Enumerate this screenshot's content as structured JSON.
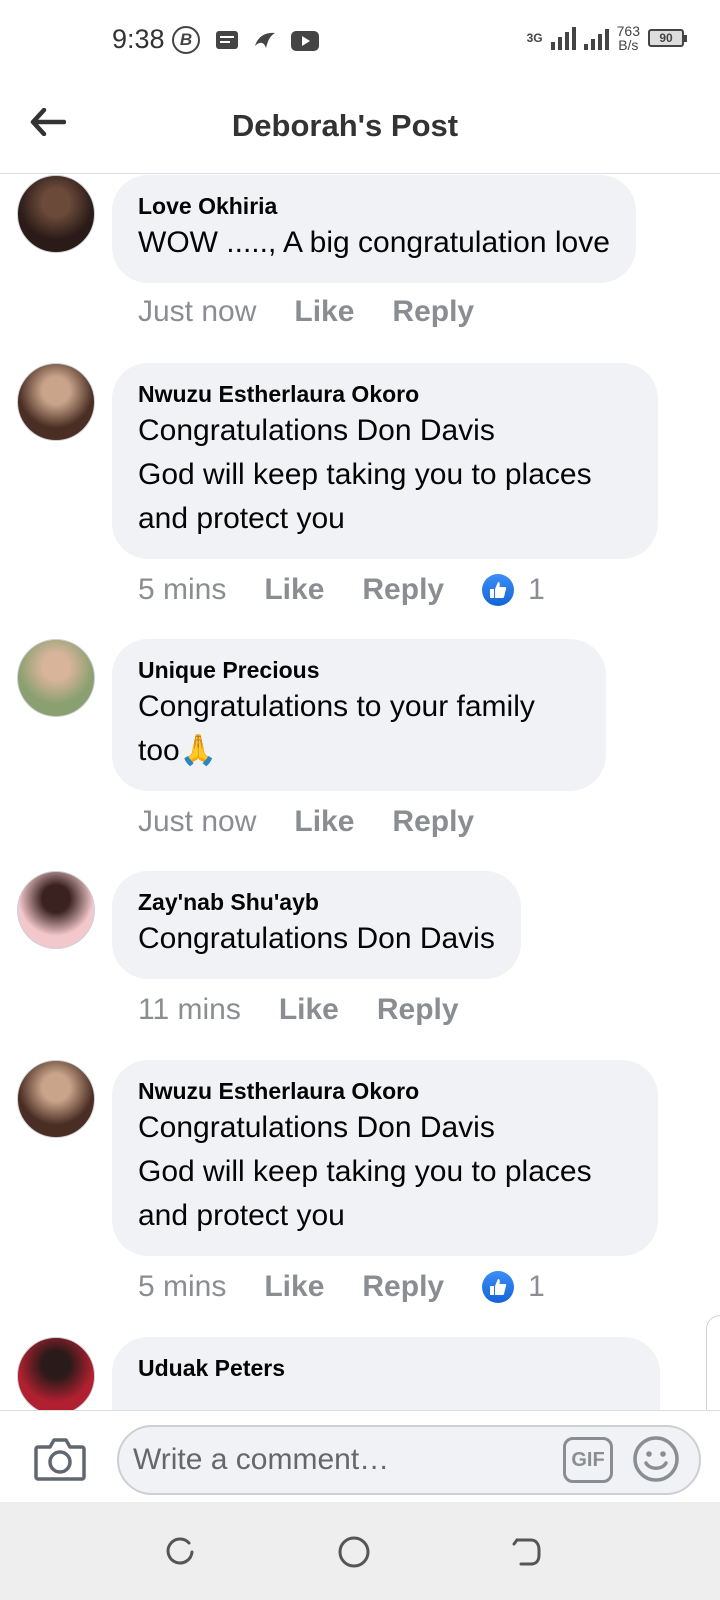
{
  "status_bar": {
    "time": "9:38",
    "b_icon": "B",
    "net_type": "3G",
    "net_speed_value": "763",
    "net_speed_unit": "B/s",
    "battery": "90"
  },
  "header": {
    "title": "Deborah's Post",
    "back_icon": "arrow-left-icon"
  },
  "comments": [
    {
      "name": "Love Okhiria",
      "text": "WOW ....., A big congratulation love",
      "time": "Just now",
      "like_label": "Like",
      "reply_label": "Reply",
      "reaction_count": null,
      "avatar_colors": [
        "#2a1a18",
        "#6b4a3a"
      ]
    },
    {
      "name": "Nwuzu Estherlaura Okoro",
      "text": "Congratulations Don Davis\nGod will keep taking you to places and protect you",
      "time": "5 mins",
      "like_label": "Like",
      "reply_label": "Reply",
      "reaction_count": "1",
      "avatar_colors": [
        "#4a2e24",
        "#c9a48a"
      ]
    },
    {
      "name": "Unique Precious",
      "text": "Congratulations to your family too🙏",
      "time": "Just now",
      "like_label": "Like",
      "reply_label": "Reply",
      "reaction_count": null,
      "avatar_colors": [
        "#8aa070",
        "#d8b49a"
      ]
    },
    {
      "name": "Zay'nab Shu'ayb",
      "text": "Congratulations Don Davis",
      "time": "11 mins",
      "like_label": "Like",
      "reply_label": "Reply",
      "reaction_count": null,
      "avatar_colors": [
        "#f3c8cc",
        "#3a2220"
      ]
    },
    {
      "name": "Nwuzu Estherlaura Okoro",
      "text": "Congratulations Don Davis\nGod will keep taking you to places and protect you",
      "time": "5 mins",
      "like_label": "Like",
      "reply_label": "Reply",
      "reaction_count": "1",
      "avatar_colors": [
        "#4a2e24",
        "#c9a48a"
      ]
    },
    {
      "name": "Uduak Peters",
      "text": "",
      "time": "",
      "like_label": "",
      "reply_label": "",
      "reaction_count": null,
      "avatar_colors": [
        "#b02030",
        "#2a1a1a"
      ]
    }
  ],
  "composer": {
    "placeholder": "Write a comment…",
    "gif_label": "GIF",
    "camera_icon": "camera-icon",
    "emoji_icon": "smiley-icon"
  },
  "navbar": {
    "icons": [
      "recent-apps-icon",
      "home-icon",
      "back-icon"
    ]
  },
  "colors": {
    "bubble": "#f0f2f5",
    "meta_text": "#8a8d91",
    "like_blue": "#1877f2"
  }
}
